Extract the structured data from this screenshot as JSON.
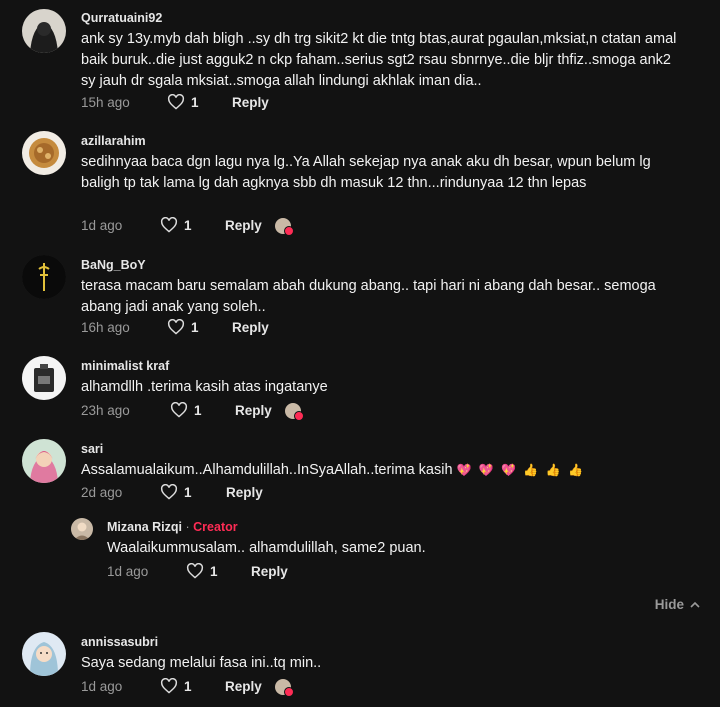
{
  "comments": [
    {
      "username": "Qurratuaini92",
      "text": "ank sy 13y.myb dah bligh ..sy dh trg sikit2 kt die tntg btas,aurat pgaulan,mksiat,n ctatan amal baik buruk..die just agguk2 n ckp faham..serius sgt2 rsau sbnrnye..die bljr thfiz..smoga ank2 sy jauh dr sgala mksiat..smoga allah lindungi akhlak iman dia..",
      "time": "15h ago",
      "likes": "1",
      "reply": "Reply"
    },
    {
      "username": "azillarahim",
      "text": "sedihnyaa baca dgn lagu nya lg..Ya Allah sekejap nya anak aku dh besar, wpun belum lg baligh tp tak lama lg dah agknya sbb dh masuk 12 thn...rindunyaa 12 thn lepas",
      "time": "1d ago",
      "likes": "1",
      "reply": "Reply"
    },
    {
      "username": "BaNg_BoY",
      "text": "terasa macam baru semalam abah dukung abang.. tapi hari ni abang dah besar.. semoga abang jadi anak yang soleh..",
      "time": "16h ago",
      "likes": "1",
      "reply": "Reply"
    },
    {
      "username": "minimalist kraf",
      "text": "alhamdllh .terima kasih atas ingatanye",
      "time": "23h ago",
      "likes": "1",
      "reply": "Reply"
    },
    {
      "username": "sari",
      "text": "Assalamualaikum..Alhamdulillah..InSyaAllah..terima kasih",
      "emojis": "💖 💖 💖 👍 👍 👍",
      "time": "2d ago",
      "likes": "1",
      "reply": "Reply"
    },
    {
      "username": "annissasubri",
      "text": "Saya sedang melalui fasa ini..tq min..",
      "time": "1d ago",
      "likes": "1",
      "reply": "Reply"
    }
  ],
  "creator_reply": {
    "username": "Mizana Rizqi",
    "separator": "·",
    "tag": "Creator",
    "text": "Waalaikummusalam.. alhamdulillah, same2 puan.",
    "time": "1d ago",
    "likes": "1",
    "reply": "Reply"
  },
  "hide_label": "Hide",
  "colors": {
    "background": "#121212",
    "creator_accent": "#fe2c55",
    "muted": "#9a9a9a"
  },
  "icons": {
    "like": "heart-outline-icon",
    "creator_liked": "creator-liked-avatar-icon",
    "hide": "chevron-up-icon"
  }
}
